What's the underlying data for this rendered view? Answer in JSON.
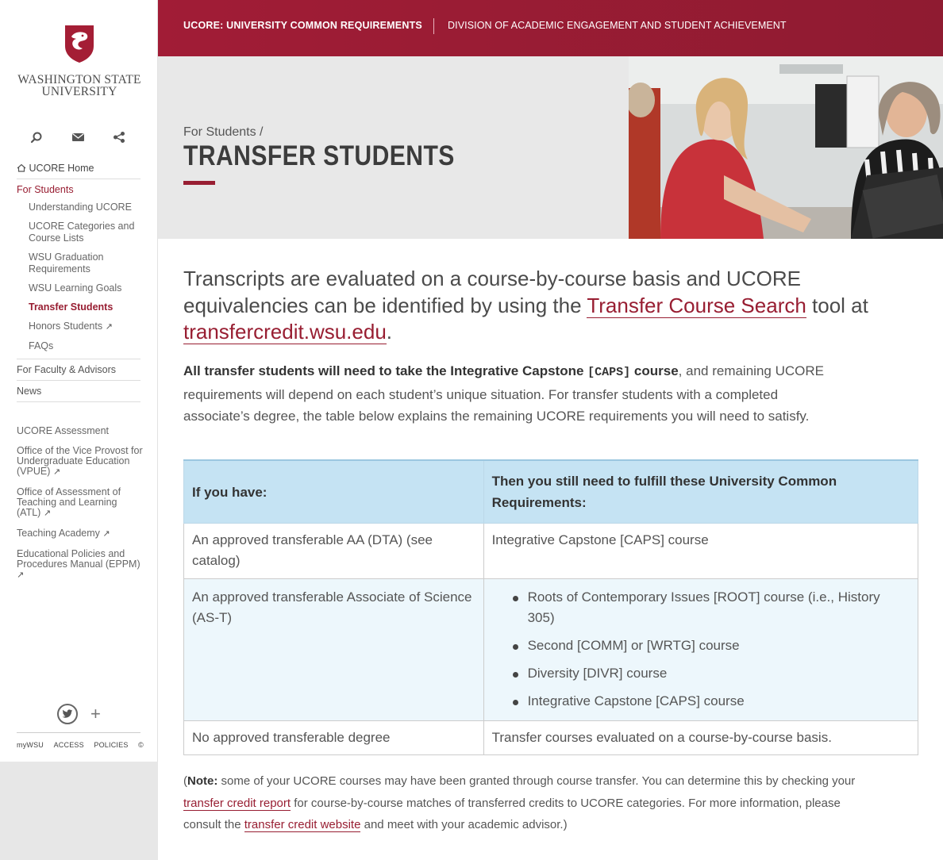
{
  "logo": {
    "line1": "Washington State",
    "line2": "University"
  },
  "sidebar_icons": [
    "search-icon",
    "email-icon",
    "share-icon"
  ],
  "nav": {
    "home": "UCORE Home",
    "for_students": "For Students",
    "sub": {
      "understanding": "Understanding UCORE",
      "categories": "UCORE Categories and Course Lists",
      "graduation": "WSU Graduation Requirements",
      "goals": "WSU Learning Goals",
      "transfer": "Transfer Students",
      "honors": "Honors Students",
      "faqs": "FAQs"
    },
    "faculty": "For Faculty & Advisors",
    "news": "News"
  },
  "nav2": {
    "assessment": "UCORE Assessment",
    "vpue": "Office of the Vice Provost for Undergraduate Education (VPUE)",
    "atl": "Office of Assessment of Teaching and Learning (ATL)",
    "academy": "Teaching Academy",
    "eppm": "Educational Policies and Procedures Manual (EPPM)"
  },
  "ext_glyph": "↗",
  "social": {
    "plus": "+"
  },
  "footer": {
    "mywsu": "myWSU",
    "access": "ACCESS",
    "policies": "POLICIES",
    "copyright": "©"
  },
  "header": {
    "site_title": "UCORE: UNIVERSITY COMMON REQUIREMENTS",
    "division": "DIVISION OF ACADEMIC ENGAGEMENT AND STUDENT ACHIEVEMENT"
  },
  "hero": {
    "breadcrumb": "For Students /",
    "title": "TRANSFER STUDENTS"
  },
  "lead": {
    "before_link": "Transcripts are evaluated on a course-by-course basis and UCORE equivalencies can be identified by using the ",
    "link1": "Transfer Course Search",
    "middle": " tool at ",
    "link2": "transfercredit.wsu.edu",
    "end": "."
  },
  "para": {
    "bold_start": "All transfer students will need to take the Integrative Capstone ",
    "code": "[CAPS]",
    "bold_end": " course",
    "rest": ", and remaining UCORE requirements will depend on each student’s unique situation. For transfer students with a completed associate’s degree, the table below explains the remaining UCORE requirements you will need to satisfy."
  },
  "table": {
    "headers": [
      "If you have:",
      "Then you still need to fulfill these University Common Requirements:"
    ],
    "row1": {
      "have": "An approved transferable AA (DTA) (see catalog)",
      "need": "Integrative Capstone [CAPS] course"
    },
    "row2": {
      "have": "An approved transferable Associate of Science (AS-T)",
      "needs": [
        "Roots of Contemporary Issues [ROOT] course (i.e., History 305)",
        "Second [COMM] or [WRTG] course",
        "Diversity [DIVR] course",
        "Integrative Capstone [CAPS] course"
      ]
    },
    "row3": {
      "have": "No approved transferable degree",
      "need": "Transfer courses evaluated on a course-by-course basis."
    }
  },
  "note": {
    "open": "(",
    "label": "Note:",
    "text1": " some of your UCORE courses may have been granted through course transfer. You can determine this by checking your ",
    "link1": "transfer credit report",
    "text2": " for course-by-course matches of transferred credits to UCORE categories. For more information, please consult the ",
    "link2": "transfer credit website",
    "text3": " and meet with your academic advisor.)"
  },
  "colors": {
    "crimson": "#981e32",
    "header_bg": "#9c1c34",
    "table_header": "#c5e3f3",
    "table_shade": "#edf7fc"
  }
}
